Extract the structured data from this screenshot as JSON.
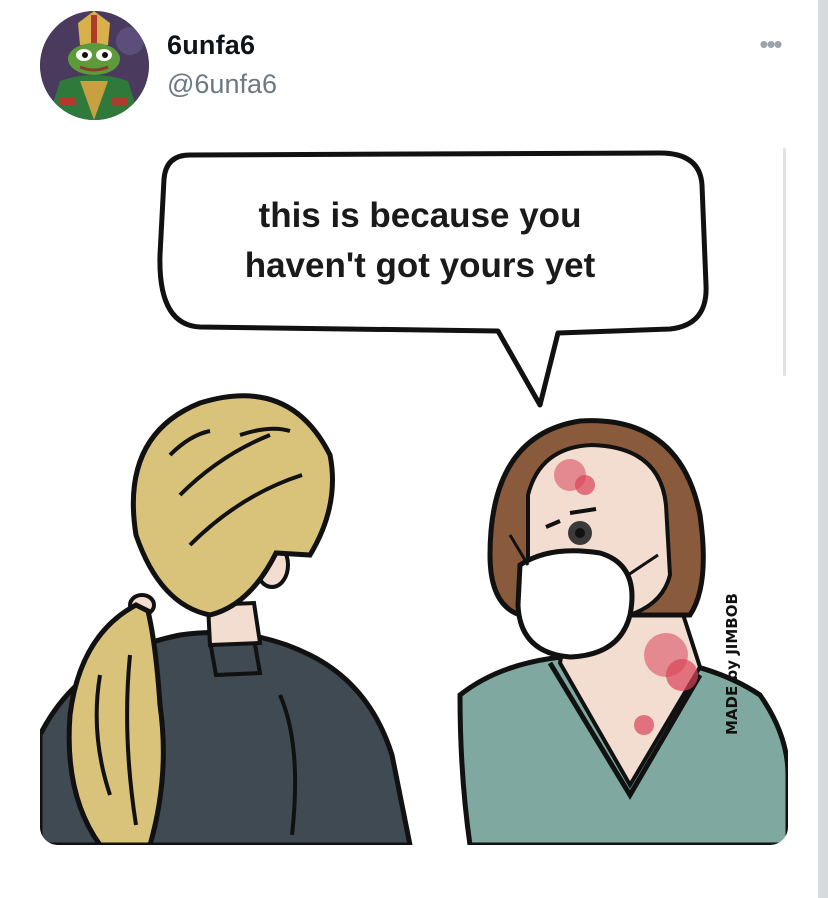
{
  "tweet": {
    "display_name": "6unfa6",
    "handle": "@6unfa6",
    "more_label": "•••"
  },
  "avatar": {
    "icon": "pepe-frog-bishop-avatar-icon"
  },
  "media": {
    "speech_bubble": {
      "line1": "this is because you",
      "line2": "haven't got yours yet"
    },
    "signature": "MADE by JIMBOB"
  },
  "colors": {
    "name": "#0f1419",
    "handle": "#6b7885",
    "jacket": "#3f4a52",
    "scrubs": "#7fa9a0",
    "blonde_hair": "#d9c27a",
    "brown_hair": "#8a5a3c",
    "skin": "#f3dcd0",
    "rash": "#d9455a"
  }
}
